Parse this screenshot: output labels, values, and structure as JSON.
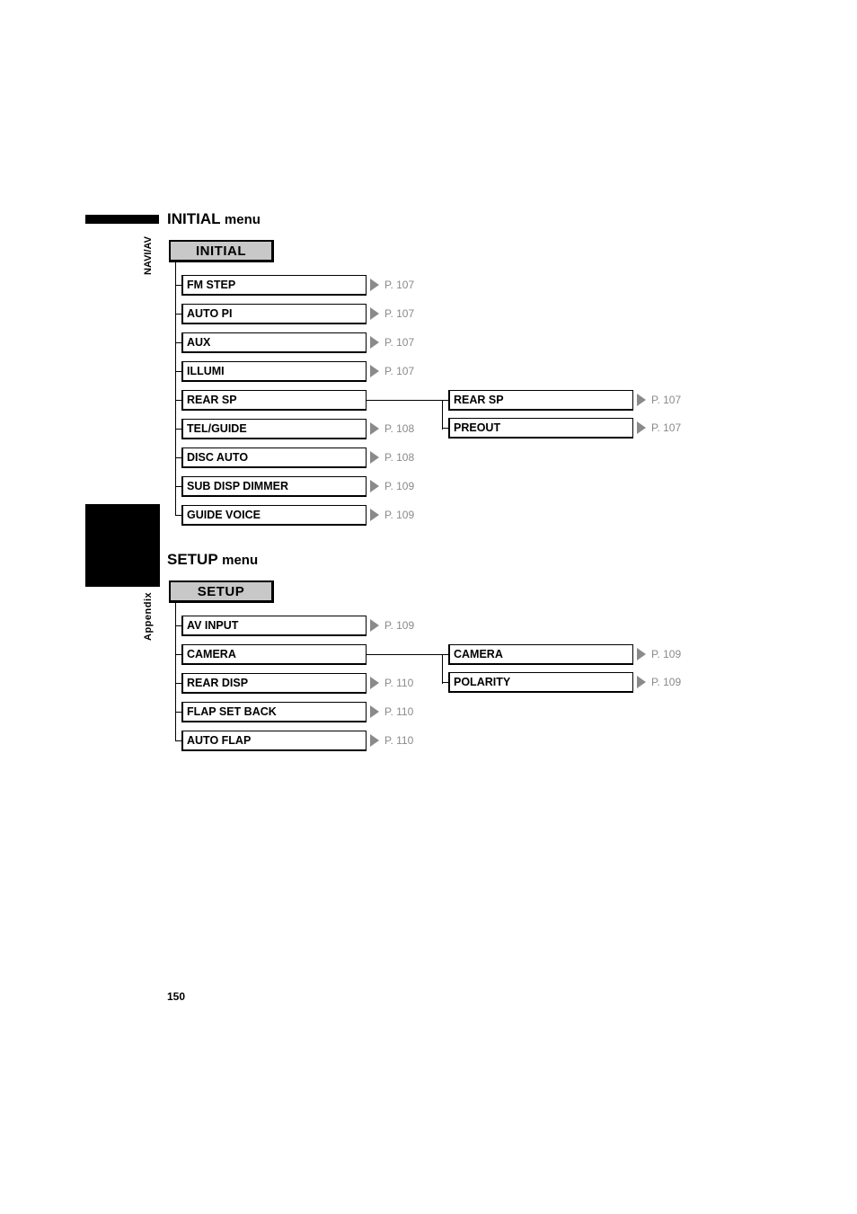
{
  "side_tabs": {
    "top": "NAVI/AV",
    "bottom": "Appendix"
  },
  "initial_section": {
    "title": "INITIAL",
    "title_suffix": "menu",
    "root": "INITIAL",
    "items": [
      {
        "label": "FM STEP",
        "ref": "P. 107"
      },
      {
        "label": "AUTO PI",
        "ref": "P. 107"
      },
      {
        "label": "AUX",
        "ref": "P. 107"
      },
      {
        "label": "ILLUMI",
        "ref": "P. 107"
      },
      {
        "label": "REAR SP",
        "ref": null,
        "children": [
          {
            "label": "REAR SP",
            "ref": "P. 107"
          },
          {
            "label": "PREOUT",
            "ref": "P. 107"
          }
        ]
      },
      {
        "label": "TEL/GUIDE",
        "ref": "P. 108"
      },
      {
        "label": "DISC AUTO",
        "ref": "P. 108"
      },
      {
        "label": "SUB DISP DIMMER",
        "ref": "P. 109"
      },
      {
        "label": "GUIDE VOICE",
        "ref": "P. 109"
      }
    ]
  },
  "setup_section": {
    "title": "SETUP",
    "title_suffix": "menu",
    "root": "SETUP",
    "items": [
      {
        "label": "AV INPUT",
        "ref": "P. 109"
      },
      {
        "label": "CAMERA",
        "ref": null,
        "children": [
          {
            "label": "CAMERA",
            "ref": "P. 109"
          },
          {
            "label": "POLARITY",
            "ref": "P. 109"
          }
        ]
      },
      {
        "label": "REAR DISP",
        "ref": "P. 110"
      },
      {
        "label": "FLAP SET BACK",
        "ref": "P. 110"
      },
      {
        "label": "AUTO FLAP",
        "ref": "P. 110"
      }
    ]
  },
  "page_number": "150"
}
